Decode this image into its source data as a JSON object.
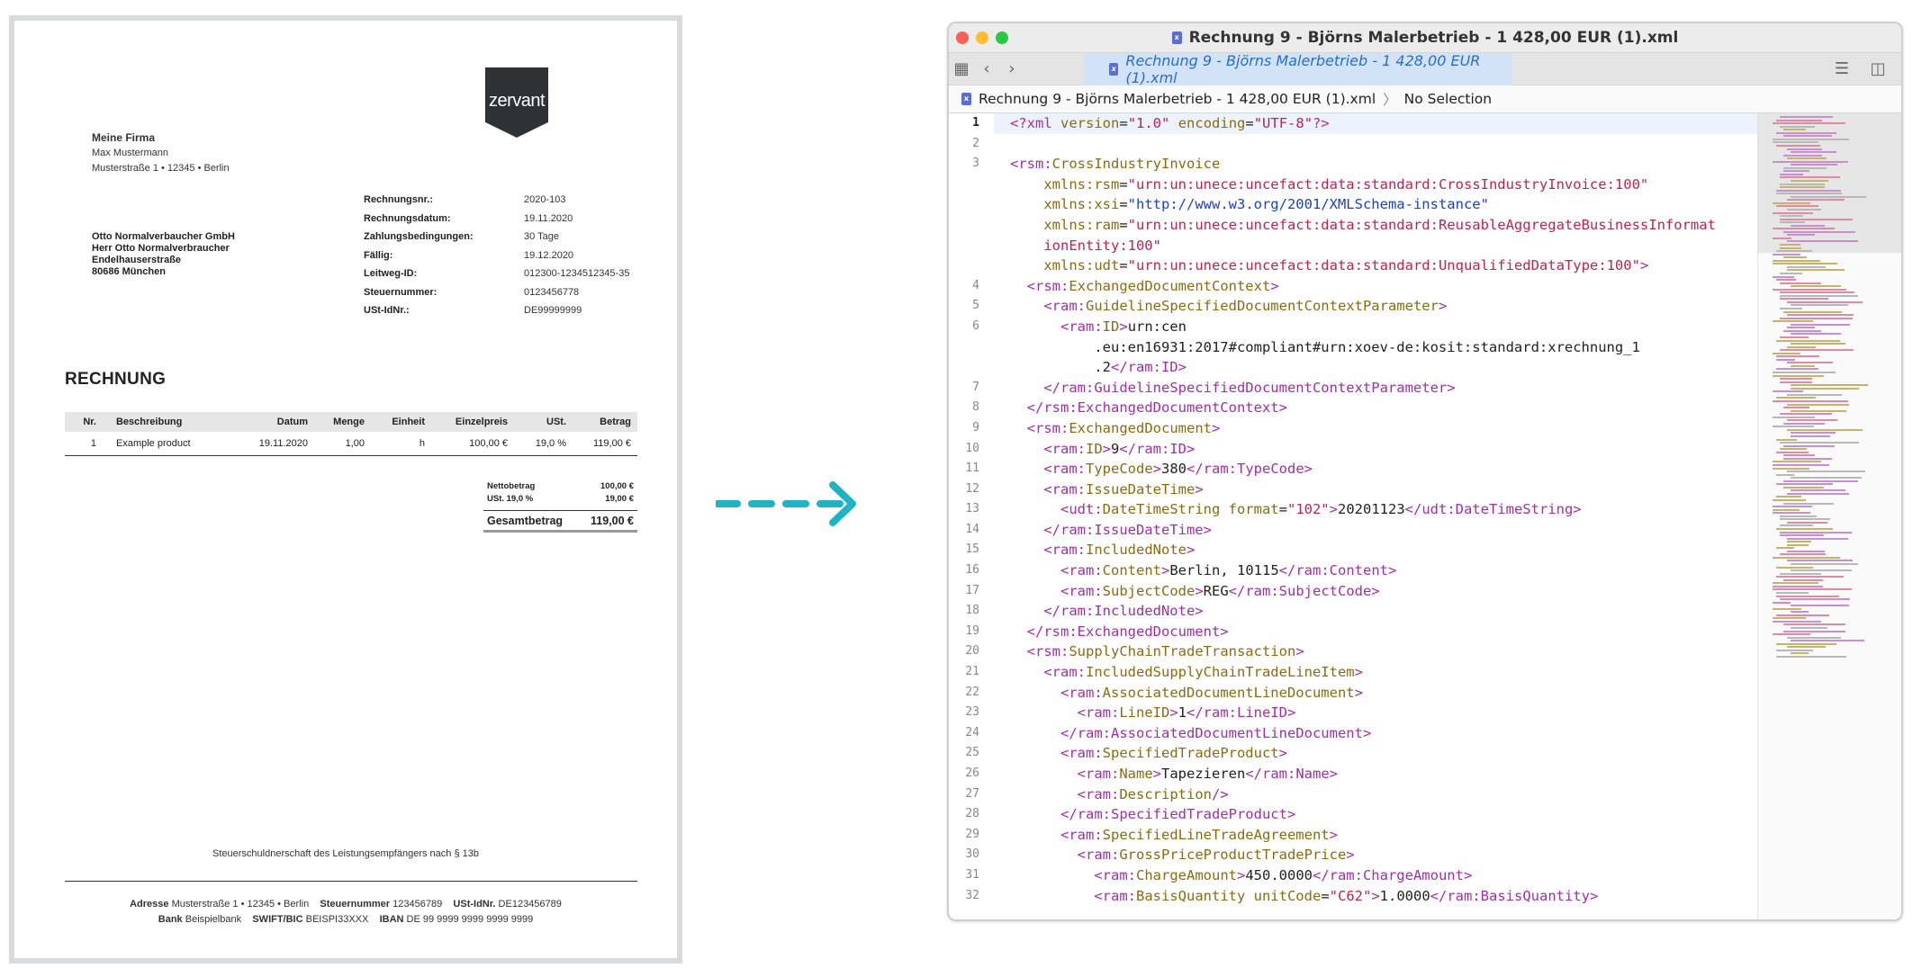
{
  "invoice": {
    "logo_text": "zervant",
    "sender": {
      "company": "Meine Firma",
      "name": "Max Mustermann",
      "address": "Musterstraße 1 • 12345 • Berlin"
    },
    "recipient": [
      "Otto Normalverbaucher GmbH",
      "Herr Otto Normalverbraucher",
      "Endelhauserstraße",
      "80686 München"
    ],
    "meta": [
      {
        "k": "Rechnungsnr.:",
        "v": "2020-103"
      },
      {
        "k": "Rechnungsdatum:",
        "v": "19.11.2020"
      },
      {
        "k": "Zahlungsbedingungen:",
        "v": "30 Tage"
      },
      {
        "k": "Fällig:",
        "v": "19.12.2020"
      },
      {
        "k": "Leitweg-ID:",
        "v": "012300-1234512345-35"
      },
      {
        "k": "Steuernummer:",
        "v": "0123456778"
      },
      {
        "k": "USt-IdNr.:",
        "v": "DE99999999"
      }
    ],
    "heading": "RECHNUNG",
    "columns": [
      "Nr.",
      "Beschreibung",
      "Datum",
      "Menge",
      "Einheit",
      "Einzelpreis",
      "USt.",
      "Betrag"
    ],
    "rows": [
      [
        "1",
        "Example product",
        "19.11.2020",
        "1,00",
        "h",
        "100,00 €",
        "19,0 %",
        "119,00 €"
      ]
    ],
    "totals": {
      "net_label": "Nettobetrag",
      "net": "100,00 €",
      "tax_label": "USt. 19,0 %",
      "tax": "19,00 €",
      "gross_label": "Gesamtbetrag",
      "gross": "119,00 €"
    },
    "reverse_charge": "Steuerschuldnerschaft des Leistungsempfängers nach § 13b",
    "footer": {
      "adresse_label": "Adresse",
      "adresse": "Musterstraße 1 • 12345 • Berlin",
      "steuer_label": "Steuernummer",
      "steuer": "123456789",
      "ustid_label": "USt-IdNr.",
      "ustid": "DE123456789",
      "bank_label": "Bank",
      "bank": "Beispielbank",
      "swift_label": "SWIFT/BIC",
      "swift": "BEISPI33XXX",
      "iban_label": "IBAN",
      "iban": "DE 99 9999 9999 9999 9999"
    }
  },
  "colors": {
    "arrow": "#1fb3c4",
    "tab": "#d3e3f7",
    "tag": "#a22ea8",
    "attr": "#8a6b10",
    "string": "#c4214e",
    "url": "#1d3fc6"
  },
  "window": {
    "title": "Rechnung 9 - Björns Malerbetrieb - 1 428,00 EUR (1).xml",
    "tab_label": "Rechnung 9 - Björns Malerbetrieb - 1 428,00 EUR (1).xml",
    "breadcrumb_file": "Rechnung 9 - Björns Malerbetrieb - 1 428,00 EUR (1).xml",
    "breadcrumb_selection": "No Selection",
    "icons": [
      "grid-icon",
      "back-icon",
      "forward-icon",
      "file-icon",
      "inspector-icon",
      "split-icon"
    ],
    "code_lines": [
      {
        "n": "1",
        "html": "<span class='tg'>&lt;?xml</span> <span class='nm'>version</span>=<span class='st'>\"1.0\"</span> <span class='nm'>encoding</span>=<span class='st'>\"UTF-8\"</span><span class='tg'>?&gt;</span>"
      },
      {
        "n": "2",
        "html": ""
      },
      {
        "n": "3",
        "html": "<span class='tg'>&lt;rsm:</span><span class='nm'>CrossIndustryInvoice</span>"
      },
      {
        "n": "",
        "html": "    <span class='nm'>xmlns:rsm</span>=<span class='st'>\"urn:un:unece:uncefact:data:standard:CrossIndustryInvoice:100\"</span>"
      },
      {
        "n": "",
        "html": "    <span class='nm'>xmlns:xsi</span>=<span class='ur'>\"http://www.w3.org/2001/XMLSchema-instance\"</span>"
      },
      {
        "n": "",
        "html": "    <span class='nm'>xmlns:ram</span>=<span class='st'>\"urn:un:unece:uncefact:data:standard:ReusableAggregateBusinessInformat</span>"
      },
      {
        "n": "",
        "html": "    <span class='st'>ionEntity:100\"</span>"
      },
      {
        "n": "",
        "html": "    <span class='nm'>xmlns:udt</span>=<span class='st'>\"urn:un:unece:uncefact:data:standard:UnqualifiedDataType:100\"</span><span class='tg'>&gt;</span>"
      },
      {
        "n": "4",
        "html": "  <span class='tg'>&lt;rsm:</span><span class='nm'>ExchangedDocumentContext</span><span class='tg'>&gt;</span>"
      },
      {
        "n": "5",
        "html": "    <span class='tg'>&lt;ram:</span><span class='nm'>GuidelineSpecifiedDocumentContextParameter</span><span class='tg'>&gt;</span>"
      },
      {
        "n": "6",
        "html": "      <span class='tg'>&lt;ram:</span><span class='nm'>ID</span><span class='tg'>&gt;</span>urn:cen"
      },
      {
        "n": "",
        "html": "          .eu:en16931:2017#compliant#urn:xoev-de:kosit:standard:xrechnung_1"
      },
      {
        "n": "",
        "html": "          .2<span class='tg'>&lt;/ram:ID&gt;</span>"
      },
      {
        "n": "7",
        "html": "    <span class='tg'>&lt;/ram:GuidelineSpecifiedDocumentContextParameter&gt;</span>"
      },
      {
        "n": "8",
        "html": "  <span class='tg'>&lt;/rsm:ExchangedDocumentContext&gt;</span>"
      },
      {
        "n": "9",
        "html": "  <span class='tg'>&lt;rsm:</span><span class='nm'>ExchangedDocument</span><span class='tg'>&gt;</span>"
      },
      {
        "n": "10",
        "html": "    <span class='tg'>&lt;ram:</span><span class='nm'>ID</span><span class='tg'>&gt;</span>9<span class='tg'>&lt;/ram:ID&gt;</span>"
      },
      {
        "n": "11",
        "html": "    <span class='tg'>&lt;ram:</span><span class='nm'>TypeCode</span><span class='tg'>&gt;</span>380<span class='tg'>&lt;/ram:TypeCode&gt;</span>"
      },
      {
        "n": "12",
        "html": "    <span class='tg'>&lt;ram:</span><span class='nm'>IssueDateTime</span><span class='tg'>&gt;</span>"
      },
      {
        "n": "13",
        "html": "      <span class='tg'>&lt;udt:</span><span class='nm'>DateTimeString format</span>=<span class='st'>\"102\"</span><span class='tg'>&gt;</span>20201123<span class='tg'>&lt;/udt:DateTimeString&gt;</span>"
      },
      {
        "n": "14",
        "html": "    <span class='tg'>&lt;/ram:IssueDateTime&gt;</span>"
      },
      {
        "n": "15",
        "html": "    <span class='tg'>&lt;ram:</span><span class='nm'>IncludedNote</span><span class='tg'>&gt;</span>"
      },
      {
        "n": "16",
        "html": "      <span class='tg'>&lt;ram:</span><span class='nm'>Content</span><span class='tg'>&gt;</span>Berlin, 10115<span class='tg'>&lt;/ram:Content&gt;</span>"
      },
      {
        "n": "17",
        "html": "      <span class='tg'>&lt;ram:</span><span class='nm'>SubjectCode</span><span class='tg'>&gt;</span>REG<span class='tg'>&lt;/ram:SubjectCode&gt;</span>"
      },
      {
        "n": "18",
        "html": "    <span class='tg'>&lt;/ram:IncludedNote&gt;</span>"
      },
      {
        "n": "19",
        "html": "  <span class='tg'>&lt;/rsm:ExchangedDocument&gt;</span>"
      },
      {
        "n": "20",
        "html": "  <span class='tg'>&lt;rsm:</span><span class='nm'>SupplyChainTradeTransaction</span><span class='tg'>&gt;</span>"
      },
      {
        "n": "21",
        "html": "    <span class='tg'>&lt;ram:</span><span class='nm'>IncludedSupplyChainTradeLineItem</span><span class='tg'>&gt;</span>"
      },
      {
        "n": "22",
        "html": "      <span class='tg'>&lt;ram:</span><span class='nm'>AssociatedDocumentLineDocument</span><span class='tg'>&gt;</span>"
      },
      {
        "n": "23",
        "html": "        <span class='tg'>&lt;ram:</span><span class='nm'>LineID</span><span class='tg'>&gt;</span>1<span class='tg'>&lt;/ram:LineID&gt;</span>"
      },
      {
        "n": "24",
        "html": "      <span class='tg'>&lt;/ram:AssociatedDocumentLineDocument&gt;</span>"
      },
      {
        "n": "25",
        "html": "      <span class='tg'>&lt;ram:</span><span class='nm'>SpecifiedTradeProduct</span><span class='tg'>&gt;</span>"
      },
      {
        "n": "26",
        "html": "        <span class='tg'>&lt;ram:</span><span class='nm'>Name</span><span class='tg'>&gt;</span>Tapezieren<span class='tg'>&lt;/ram:Name&gt;</span>"
      },
      {
        "n": "27",
        "html": "        <span class='tg'>&lt;ram:</span><span class='nm'>Description</span><span class='tg'>/&gt;</span>"
      },
      {
        "n": "28",
        "html": "      <span class='tg'>&lt;/ram:SpecifiedTradeProduct&gt;</span>"
      },
      {
        "n": "29",
        "html": "      <span class='tg'>&lt;ram:</span><span class='nm'>SpecifiedLineTradeAgreement</span><span class='tg'>&gt;</span>"
      },
      {
        "n": "30",
        "html": "        <span class='tg'>&lt;ram:</span><span class='nm'>GrossPriceProductTradePrice</span><span class='tg'>&gt;</span>"
      },
      {
        "n": "31",
        "html": "          <span class='tg'>&lt;ram:</span><span class='nm'>ChargeAmount</span><span class='tg'>&gt;</span>450.0000<span class='tg'>&lt;/ram:ChargeAmount&gt;</span>"
      },
      {
        "n": "32",
        "html": "          <span class='tg'>&lt;ram:</span><span class='nm'>BasisQuantity unitCode</span>=<span class='st'>\"C62\"</span><span class='tg'>&gt;</span>1.0000<span class='tg'>&lt;/ram:BasisQuantity&gt;</span>"
      }
    ]
  }
}
